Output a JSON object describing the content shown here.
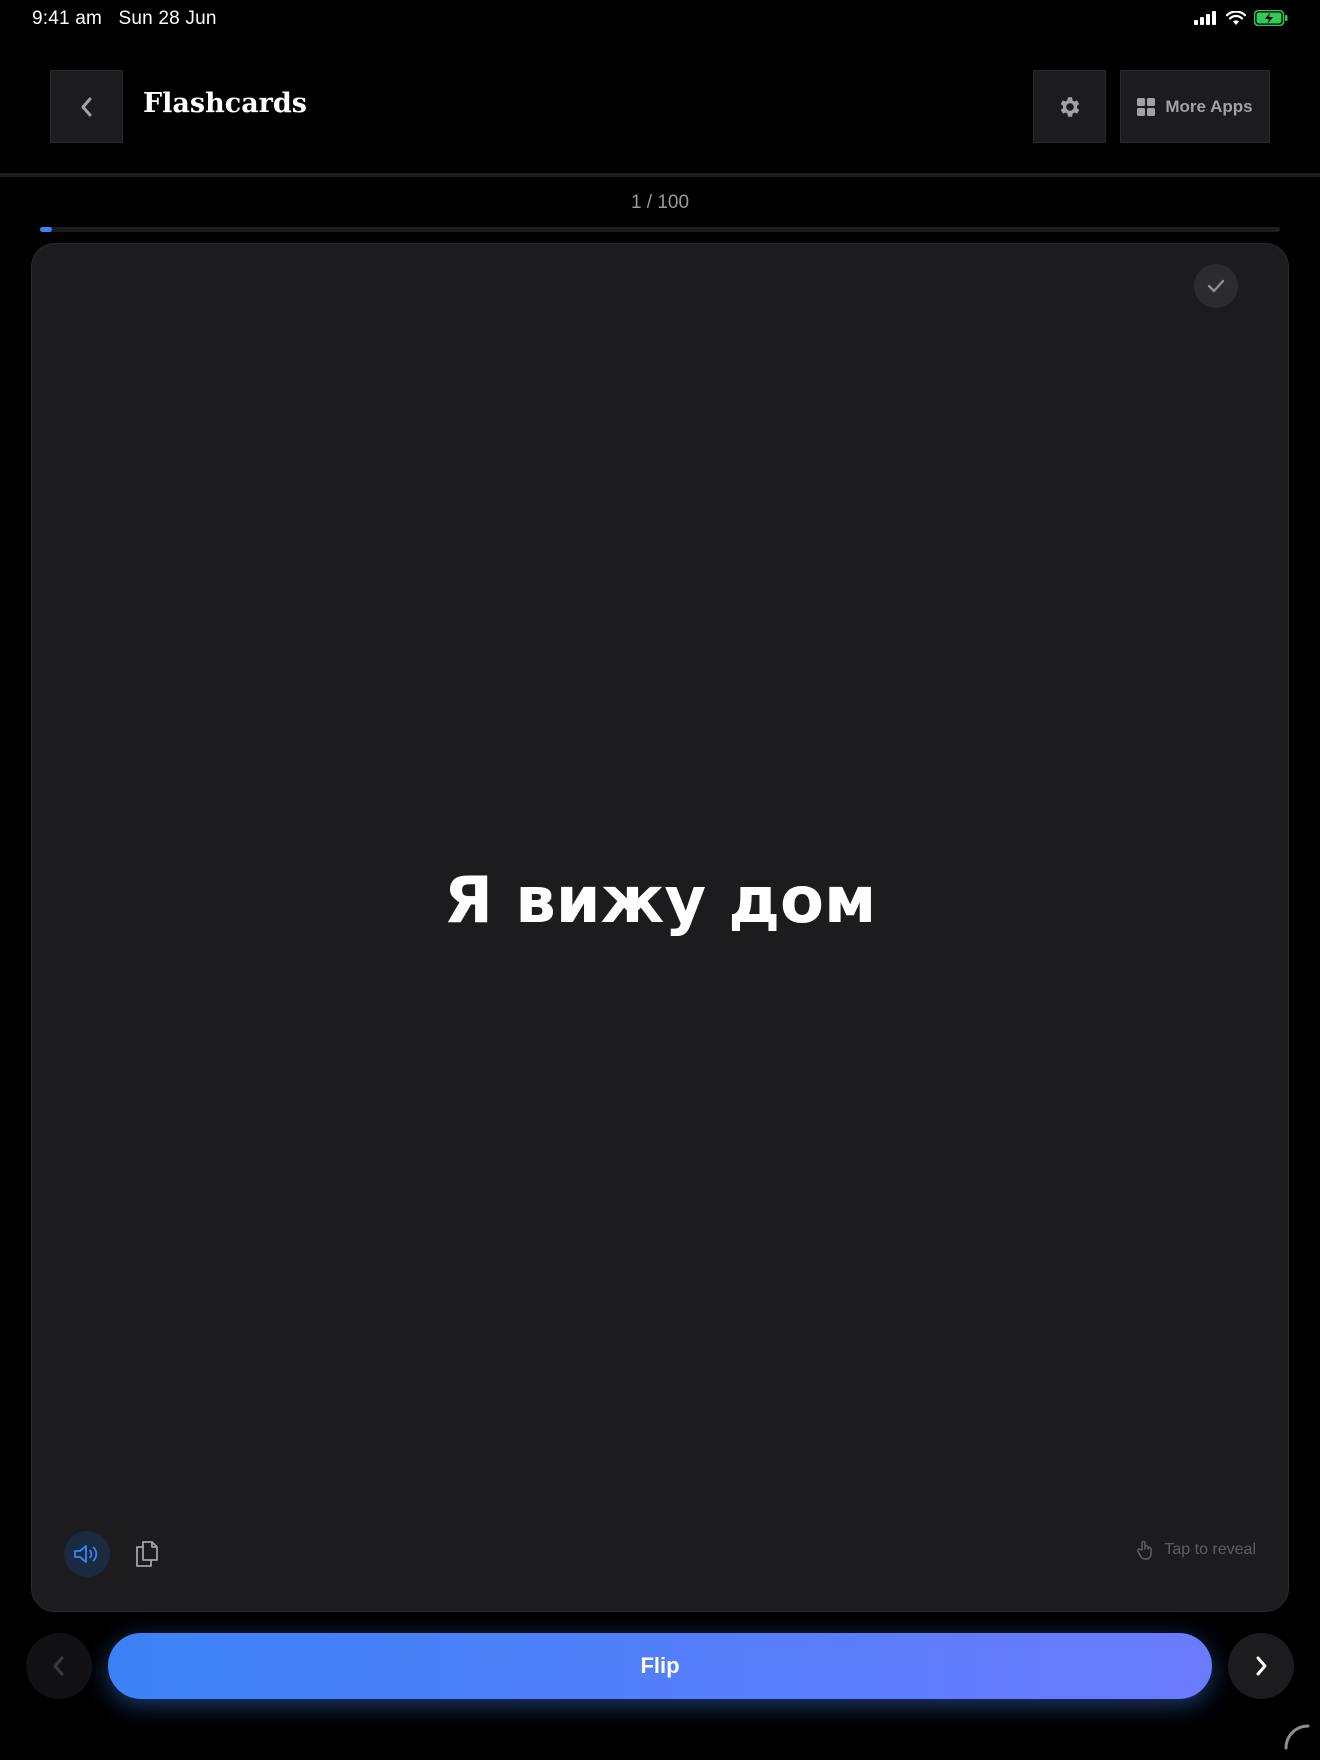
{
  "status_bar": {
    "time": "9:41 am",
    "date": "Sun 28 Jun"
  },
  "header": {
    "title": "Flashcards",
    "more_apps_label": "More Apps"
  },
  "progress": {
    "counter_text": "1 / 100",
    "current": 1,
    "total": 100
  },
  "card": {
    "text": "Я вижу дом",
    "tap_hint": "Tap to reveal"
  },
  "actions": {
    "flip_label": "Flip"
  },
  "colors": {
    "accent": "#3b82f6",
    "accent_end": "#6b7bff",
    "battery": "#34c759"
  },
  "icons": [
    "chevron-left-icon",
    "gear-icon",
    "grid-icon",
    "checkmark-icon",
    "speaker-icon",
    "copy-icon",
    "tap-icon",
    "chevron-right-icon",
    "signal-icon",
    "wifi-icon",
    "battery-icon"
  ]
}
